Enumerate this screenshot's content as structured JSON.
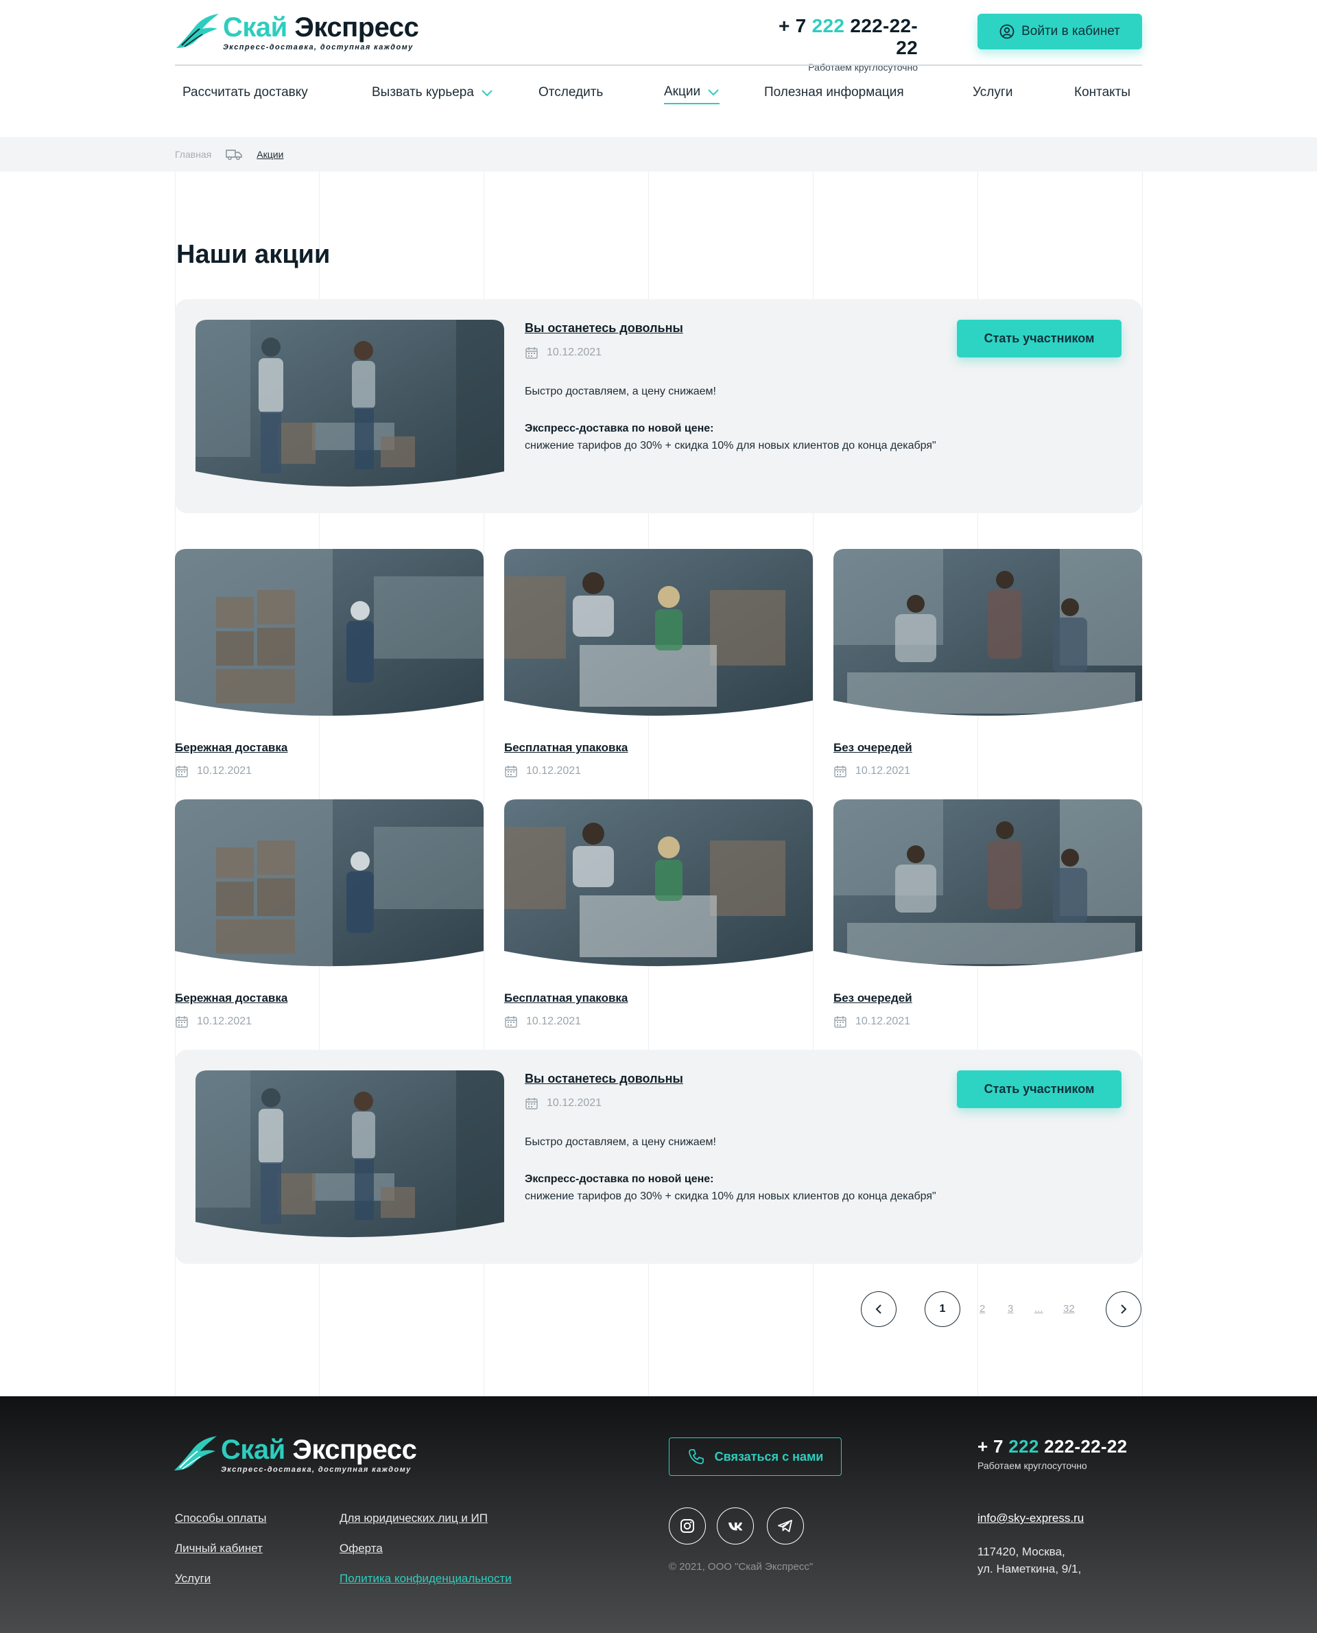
{
  "brand": {
    "name_part1": "Скай",
    "name_part2": "Экспресс",
    "tagline": "Экспресс-доставка, доступная каждому"
  },
  "header": {
    "phone_prefix": "+ 7",
    "phone_code": "222",
    "phone_number": "222-22-22",
    "phone_note": "Работаем круглосуточно",
    "login_label": "Войти в кабинет"
  },
  "nav": {
    "items": [
      {
        "label": "Рассчитать доставку"
      },
      {
        "label": "Вызвать курьера"
      },
      {
        "label": "Отследить"
      },
      {
        "label": "Акции"
      },
      {
        "label": "Полезная информация"
      },
      {
        "label": "Услуги"
      },
      {
        "label": "Контакты"
      }
    ]
  },
  "breadcrumb": {
    "home": "Главная",
    "current": "Акции"
  },
  "page": {
    "title": "Наши акции"
  },
  "featured": [
    {
      "title": "Вы останетесь довольны",
      "date": "10.12.2021",
      "lead": "Быстро доставляем, а цену снижаем!",
      "bold": "Экспресс-доставка по новой цене:",
      "text": "снижение тарифов до 30% + скидка 10% для новых клиентов до конца декабря\"",
      "button": "Стать участником"
    },
    {
      "title": "Вы останетесь довольны",
      "date": "10.12.2021",
      "lead": "Быстро доставляем, а цену снижаем!",
      "bold": "Экспресс-доставка по новой цене:",
      "text": "снижение тарифов до 30% + скидка 10% для новых клиентов до конца декабря\"",
      "button": "Стать участником"
    }
  ],
  "cards": [
    {
      "title": "Бережная доставка",
      "date": "10.12.2021"
    },
    {
      "title": "Бесплатная упаковка",
      "date": "10.12.2021"
    },
    {
      "title": "Без очередей",
      "date": "10.12.2021"
    },
    {
      "title": "Бережная доставка",
      "date": "10.12.2021"
    },
    {
      "title": "Бесплатная упаковка",
      "date": "10.12.2021"
    },
    {
      "title": "Без очередей",
      "date": "10.12.2021"
    }
  ],
  "pagination": {
    "current": "1",
    "pages": [
      "2",
      "3",
      "...",
      "32"
    ]
  },
  "footer": {
    "links_col1": [
      "Способы оплаты",
      "Личный кабинет",
      "Услуги"
    ],
    "links_col2": [
      "Для юридических лиц и ИП",
      "Оферта",
      "Политика конфиденциальности"
    ],
    "contact_button": "Связаться с нами",
    "copyright": "© 2021, ООО \"Скай Экспресс\"",
    "phone_prefix": "+ 7",
    "phone_code": "222",
    "phone_number": "222-22-22",
    "phone_note": "Работаем круглосуточно",
    "email": "info@sky-express.ru",
    "address_line1": "117420, Москва,",
    "address_line2": "ул. Наметкина, 9/1,",
    "social": [
      "instagram-icon",
      "vk-icon",
      "telegram-icon"
    ]
  },
  "colors": {
    "accent": "#2dcdbe",
    "button": "#2dd4c4",
    "dark": "#0f1e28",
    "photo_tint": "#3f5560"
  }
}
